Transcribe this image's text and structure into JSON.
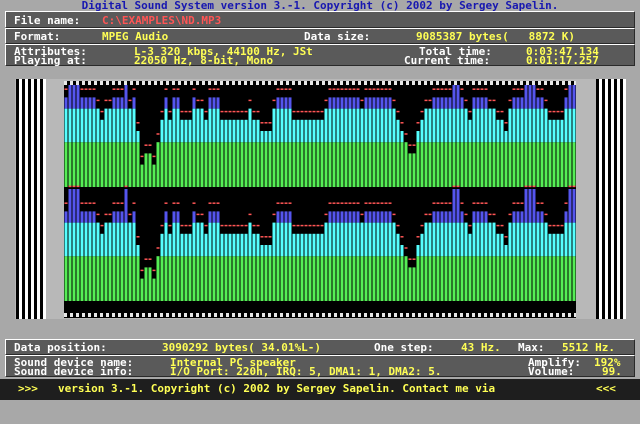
{
  "title": "Digital Sound System version 3.-1. Copyright (c) 2002 by Sergey Sapelin.",
  "file": {
    "label": "File name:",
    "value": "C:\\EXAMPLES\\ND.MP3"
  },
  "format": {
    "label": "Format:",
    "value": "MPEG Audio",
    "size_label": "Data size:",
    "size_value": "9085387 bytes(   8872 K)"
  },
  "attributes": {
    "label": "Attributes:",
    "value": "L-3 320 kbps, 44100 Hz, JSt",
    "total_label": "Total time:",
    "total_value": "0:03:47.134"
  },
  "playing": {
    "label": "Playing at:",
    "value": "22050 Hz, 8-bit, Mono",
    "current_label": "Current time:",
    "current_value": "0:01:17.257"
  },
  "position": {
    "label": "Data position:",
    "value": "3090292 bytes( 34.01%L-)",
    "step_label": "One step:",
    "step_value": "43 Hz.",
    "max_label": "Max:",
    "max_value": "5512 Hz."
  },
  "device": {
    "name_label": "Sound device name:",
    "name_value": "Internal PC speaker",
    "info_label": "Sound device info:",
    "info_value": "I/O Port: 220h, IRQ: 5, DMA1: 1, DMA2: 5.",
    "amplify_label": "Amplify:",
    "amplify_value": "192%",
    "volume_label": "Volume:",
    "volume_value": "99."
  },
  "status": {
    "left": ">>>",
    "text": "version 3.-1. Copyright (c) 2002 by Sergey Sapelin. Contact me via",
    "right": "<<<"
  },
  "colors": {
    "green": "#55ee55",
    "cyan": "#55ffff",
    "blue": "#5555ee",
    "red": "#ff5555"
  },
  "spectrum": [
    8,
    10,
    10,
    10,
    8,
    8,
    8,
    8,
    7,
    6,
    7,
    7,
    8,
    8,
    8,
    10,
    7,
    8,
    5,
    2,
    3,
    3,
    2,
    4,
    6,
    8,
    6,
    8,
    8,
    6,
    6,
    6,
    8,
    7,
    7,
    6,
    8,
    8,
    8,
    6,
    6,
    6,
    6,
    6,
    6,
    6,
    7,
    6,
    6,
    5,
    5,
    5,
    7,
    8,
    8,
    8,
    8,
    6,
    6,
    6,
    6,
    6,
    6,
    6,
    6,
    7,
    8,
    8,
    8,
    8,
    8,
    8,
    8,
    8,
    7,
    8,
    8,
    8,
    8,
    8,
    8,
    8,
    7,
    6,
    5,
    4,
    3,
    3,
    5,
    6,
    7,
    7,
    8,
    8,
    8,
    8,
    8,
    10,
    10,
    8,
    7,
    6,
    8,
    8,
    8,
    8,
    7,
    7,
    6,
    6,
    5,
    7,
    8,
    8,
    8,
    10,
    10,
    10,
    8,
    8,
    7,
    6,
    6,
    6,
    6,
    8,
    10,
    10
  ]
}
